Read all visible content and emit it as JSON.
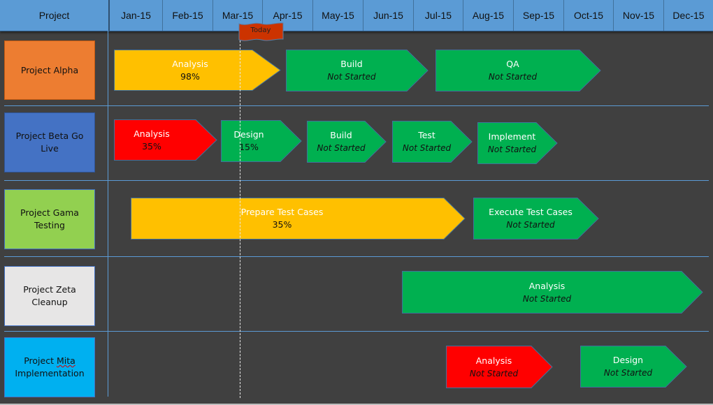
{
  "header": {
    "project_label": "Project",
    "months": [
      "Jan-15",
      "Feb-15",
      "Mar-15",
      "Apr-15",
      "May-15",
      "Jun-15",
      "Jul-15",
      "Aug-15",
      "Sep-15",
      "Oct-15",
      "Nov-15",
      "Dec-15"
    ]
  },
  "today_marker": {
    "label": "Today",
    "color": "#cc3300"
  },
  "colors": {
    "header_bg": "#5b9bd5",
    "background": "#404040",
    "in_progress": "#ffc000",
    "behind": "#ff0000",
    "not_started": "#00b050"
  },
  "projects": [
    {
      "name": "Project Alpha",
      "color": "#ed7d31",
      "tasks": [
        {
          "name": "Analysis",
          "status": "98%",
          "color": "#ffc000"
        },
        {
          "name": "Build",
          "status": "Not Started",
          "color": "#00b050"
        },
        {
          "name": "QA",
          "status": "Not Started",
          "color": "#00b050"
        }
      ]
    },
    {
      "name": "Project Beta Go Live",
      "color": "#4472c4",
      "tasks": [
        {
          "name": "Analysis",
          "status": "35%",
          "color": "#ff0000"
        },
        {
          "name": "Design",
          "status": "15%",
          "color": "#00b050"
        },
        {
          "name": "Build",
          "status": "Not Started",
          "color": "#00b050"
        },
        {
          "name": "Test",
          "status": "Not Started",
          "color": "#00b050"
        },
        {
          "name": "Implement",
          "status": "Not Started",
          "color": "#00b050"
        }
      ]
    },
    {
      "name": "Project Gama Testing",
      "color": "#92d050",
      "tasks": [
        {
          "name": "Prepare Test Cases",
          "status": "35%",
          "color": "#ffc000"
        },
        {
          "name": "Execute Test Cases",
          "status": "Not Started",
          "color": "#00b050"
        }
      ]
    },
    {
      "name": "Project Zeta Cleanup",
      "color": "#e7e6e6",
      "tasks": [
        {
          "name": "Analysis",
          "status": "Not Started",
          "color": "#00b050"
        }
      ]
    },
    {
      "name_parts": [
        "Project ",
        "Mita",
        "Implementation"
      ],
      "name": "Project Mita Implementation",
      "color": "#00b0f0",
      "tasks": [
        {
          "name": "Analysis",
          "status": "Not Started",
          "color": "#ff0000"
        },
        {
          "name": "Design",
          "status": "Not Started",
          "color": "#00b050"
        }
      ]
    }
  ]
}
